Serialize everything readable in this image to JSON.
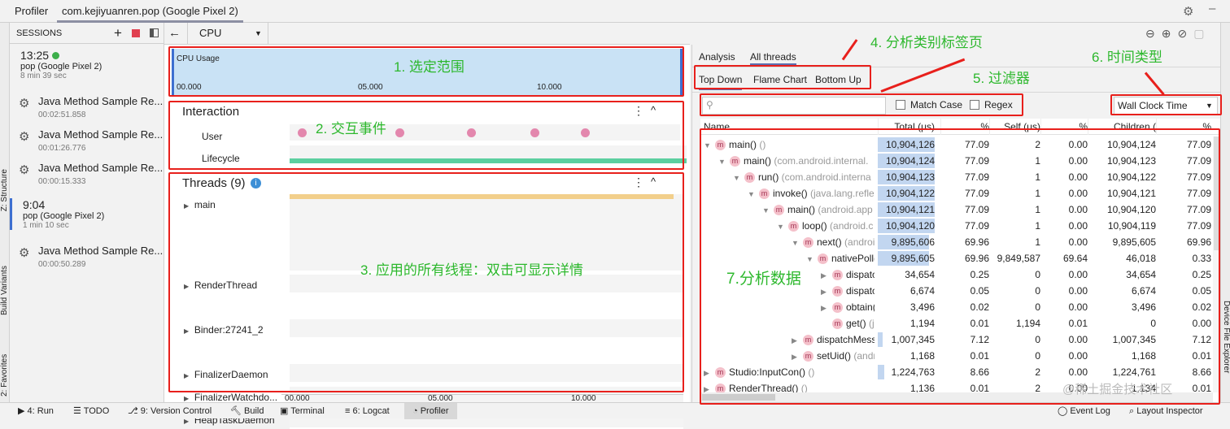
{
  "title_tabs": [
    "Profiler",
    "com.kejiyuanren.pop (Google Pixel 2)"
  ],
  "left_strip": [
    "Z: Structure",
    "Build Variants",
    "2: Favorites"
  ],
  "right_strip": "Device File Explorer",
  "sessions": {
    "header": "SESSIONS",
    "groups": [
      {
        "time": "13:25",
        "device": "pop (Google Pixel 2)",
        "duration": "8 min 39 sec",
        "live": true,
        "records": [
          {
            "name": "Java Method Sample Re...",
            "time": "00:02:51.858"
          },
          {
            "name": "Java Method Sample Re...",
            "time": "00:01:26.776"
          },
          {
            "name": "Java Method Sample Re...",
            "time": "00:00:15.333"
          }
        ]
      },
      {
        "time": "9:04",
        "device": "pop (Google Pixel 2)",
        "duration": "1 min 10 sec",
        "live": false,
        "records": [
          {
            "name": "Java Method Sample Re...",
            "time": "00:00:50.289"
          }
        ]
      }
    ]
  },
  "toolbar": {
    "back": "←",
    "profiler_select": "CPU"
  },
  "cpu": {
    "label": "CPU Usage",
    "ticks": [
      "00.000",
      "05.000",
      "10.000"
    ]
  },
  "interaction": {
    "title": "Interaction",
    "tracks": [
      "User",
      "Lifecycle"
    ]
  },
  "threads": {
    "title": "Threads (9)",
    "items": [
      "main",
      "RenderThread",
      "Binder:27241_2",
      "FinalizerDaemon",
      "FinalizerWatchdo...",
      "HeapTaskDaemon"
    ]
  },
  "time_axis": [
    "00.000",
    "05.000",
    "10.000"
  ],
  "analysis": {
    "tabs": [
      "Analysis",
      "All threads"
    ],
    "subtabs": [
      "Top Down",
      "Flame Chart",
      "Bottom Up"
    ],
    "filter": {
      "placeholder": "",
      "match_case": "Match Case",
      "regex": "Regex"
    },
    "time_type": "Wall Clock Time",
    "columns": [
      "Name",
      "Total (μs)",
      "%",
      "Self (μs)",
      "%",
      "Children (",
      "%"
    ],
    "rows": [
      {
        "lvl": 0,
        "exp": "▼",
        "name": "main()",
        "pkg": " ()",
        "total": "10,904,126",
        "tp": "77.09",
        "self": "2",
        "sp": "0.00",
        "child": "10,904,124",
        "cp": "77.09",
        "bar": 1
      },
      {
        "lvl": 1,
        "exp": "▼",
        "name": "main()",
        "pkg": " (com.android.internal.",
        "total": "10,904,124",
        "tp": "77.09",
        "self": "1",
        "sp": "0.00",
        "child": "10,904,123",
        "cp": "77.09",
        "bar": 1
      },
      {
        "lvl": 2,
        "exp": "▼",
        "name": "run()",
        "pkg": " (com.android.interna",
        "total": "10,904,123",
        "tp": "77.09",
        "self": "1",
        "sp": "0.00",
        "child": "10,904,122",
        "cp": "77.09",
        "bar": 1
      },
      {
        "lvl": 3,
        "exp": "▼",
        "name": "invoke()",
        "pkg": " (java.lang.refle",
        "total": "10,904,122",
        "tp": "77.09",
        "self": "1",
        "sp": "0.00",
        "child": "10,904,121",
        "cp": "77.09",
        "bar": 1
      },
      {
        "lvl": 4,
        "exp": "▼",
        "name": "main()",
        "pkg": " (android.app",
        "total": "10,904,121",
        "tp": "77.09",
        "self": "1",
        "sp": "0.00",
        "child": "10,904,120",
        "cp": "77.09",
        "bar": 1
      },
      {
        "lvl": 5,
        "exp": "▼",
        "name": "loop()",
        "pkg": " (android.c",
        "total": "10,904,120",
        "tp": "77.09",
        "self": "1",
        "sp": "0.00",
        "child": "10,904,119",
        "cp": "77.09",
        "bar": 1
      },
      {
        "lvl": 6,
        "exp": "▼",
        "name": "next()",
        "pkg": " (androi",
        "total": "9,895,606",
        "tp": "69.96",
        "self": "1",
        "sp": "0.00",
        "child": "9,895,605",
        "cp": "69.96",
        "bar": 0.9
      },
      {
        "lvl": 7,
        "exp": "▼",
        "name": "nativePoll(",
        "pkg": "",
        "total": "9,895,605",
        "tp": "69.96",
        "self": "9,849,587",
        "sp": "69.64",
        "child": "46,018",
        "cp": "0.33",
        "bar": 0.9
      },
      {
        "lvl": 8,
        "exp": "▶",
        "name": "dispatc",
        "pkg": "",
        "total": "34,654",
        "tp": "0.25",
        "self": "0",
        "sp": "0.00",
        "child": "34,654",
        "cp": "0.25",
        "bar": 0
      },
      {
        "lvl": 8,
        "exp": "▶",
        "name": "dispatc",
        "pkg": "",
        "total": "6,674",
        "tp": "0.05",
        "self": "0",
        "sp": "0.00",
        "child": "6,674",
        "cp": "0.05",
        "bar": 0
      },
      {
        "lvl": 8,
        "exp": "▶",
        "name": "obtain(",
        "pkg": "",
        "total": "3,496",
        "tp": "0.02",
        "self": "0",
        "sp": "0.00",
        "child": "3,496",
        "cp": "0.02",
        "bar": 0
      },
      {
        "lvl": 8,
        "exp": "",
        "name": "get()",
        "pkg": " (ja",
        "total": "1,194",
        "tp": "0.01",
        "self": "1,194",
        "sp": "0.01",
        "child": "0",
        "cp": "0.00",
        "bar": 0
      },
      {
        "lvl": 6,
        "exp": "▶",
        "name": "dispatchMess",
        "pkg": "",
        "total": "1,007,345",
        "tp": "7.12",
        "self": "0",
        "sp": "0.00",
        "child": "1,007,345",
        "cp": "7.12",
        "bar": 0.09
      },
      {
        "lvl": 6,
        "exp": "▶",
        "name": "setUid()",
        "pkg": " (andr",
        "total": "1,168",
        "tp": "0.01",
        "self": "0",
        "sp": "0.00",
        "child": "1,168",
        "cp": "0.01",
        "bar": 0
      },
      {
        "lvl": 0,
        "exp": "▶",
        "name": "Studio:InputCon()",
        "pkg": " ()",
        "total": "1,224,763",
        "tp": "8.66",
        "self": "2",
        "sp": "0.00",
        "child": "1,224,761",
        "cp": "8.66",
        "bar": 0.11
      },
      {
        "lvl": 0,
        "exp": "▶",
        "name": "RenderThread()",
        "pkg": " ()",
        "total": "1,136",
        "tp": "0.01",
        "self": "2",
        "sp": "0.00",
        "child": "1,134",
        "cp": "0.01",
        "bar": 0
      }
    ]
  },
  "bottom_bar": [
    "4: Run",
    "TODO",
    "9: Version Control",
    "Build",
    "Terminal",
    "6: Logcat",
    "Profiler",
    "Event Log",
    "Layout Inspector"
  ],
  "annotations": [
    "1. 选定范围",
    "2. 交互事件",
    "3. 应用的所有线程：双击可显示详情",
    "4. 分析类别标签页",
    "5. 过滤器",
    "6. 时间类型",
    "7.分析数据"
  ],
  "watermark": "@稀土掘金技术社区",
  "colors": {
    "annotation_red": "#e8201c",
    "annotation_green": "#2db82d",
    "cpu_bg": "#c9e2f5",
    "bar": "#c2d6f0"
  }
}
